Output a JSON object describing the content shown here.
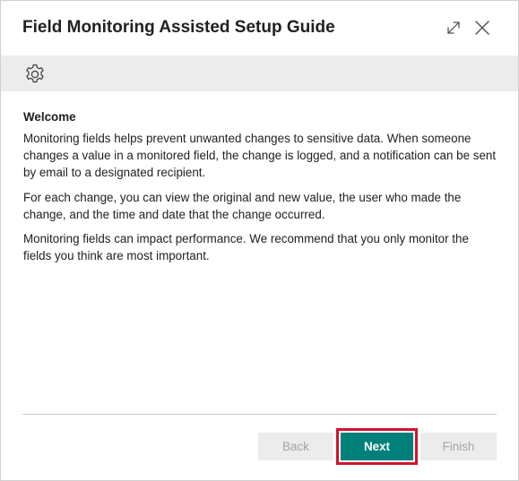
{
  "dialog": {
    "title": "Field Monitoring Assisted Setup Guide"
  },
  "header": {
    "expand_icon": "expand-arrows-icon",
    "close_icon": "close-icon"
  },
  "toolbar": {
    "settings_icon": "gear-icon"
  },
  "content": {
    "heading": "Welcome",
    "paragraphs": [
      "Monitoring fields helps prevent unwanted changes to sensitive data. When someone changes a value in a monitored field, the change is logged, and a notification can be sent by email to a designated recipient.",
      "For each change, you can view the original and new value, the user who made the change, and the time and date that the change occurred.",
      "Monitoring fields can impact performance. We recommend that you only monitor the fields you think are most important."
    ]
  },
  "footer": {
    "back_label": "Back",
    "next_label": "Next",
    "finish_label": "Finish",
    "primary_color": "#00807a",
    "highlight_color": "#d0132e"
  }
}
